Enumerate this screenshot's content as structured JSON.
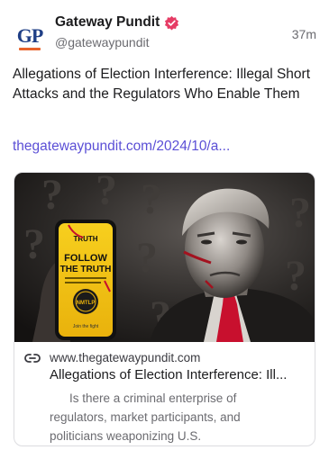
{
  "author": {
    "avatar_text": "GP",
    "display_name": "Gateway Pundit",
    "handle": "@gatewaypundit",
    "verified_icon": "verified-badge-icon",
    "badge_color": "#e63c65"
  },
  "post": {
    "timestamp": "37m",
    "text": "Allegations of Election Interference: Illegal Short Attacks and the Regulators Who Enable Them",
    "link_text": "thegatewaypundit.com/2024/10/a..."
  },
  "card": {
    "domain": "www.thegatewaypundit.com",
    "title": "Allegations of Election Interference: Ill...",
    "description": "Is there a criminal enterprise of regulators, market participants, and politicians weaponizing U.S.",
    "link_icon": "link-icon",
    "image": {
      "phone_header": "TRUTH",
      "phone_headline_1": "FOLLOW",
      "phone_headline_2": "THE TRUTH",
      "phone_seal": "NMTLP",
      "phone_footer": "Join the fight"
    }
  },
  "colors": {
    "link": "#5b4fd6",
    "brand_blue": "#1f3f86",
    "brand_orange": "#e8622a",
    "muted": "#6b6b70"
  }
}
